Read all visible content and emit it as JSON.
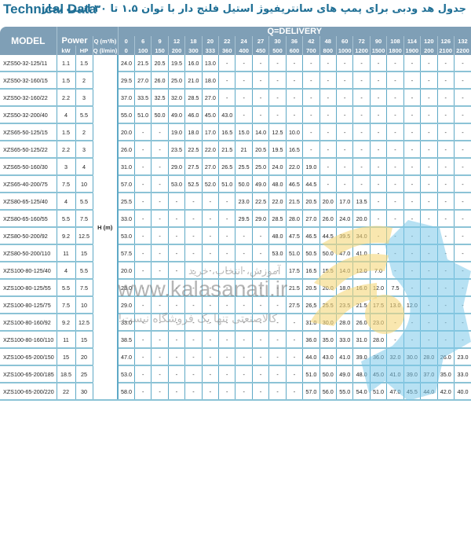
{
  "header": {
    "title_en": "Technical Data",
    "title_fa": "جدول هد ودبی برای پمپ های سانتریفیوژ استیل فلنج دار با توان ۱.۵ تا ۳۰ اسب بخار"
  },
  "table": {
    "model_label": "MODEL",
    "power_label": "Power",
    "kw_label": "kW",
    "hp_label": "HP",
    "q_m3h_label": "Q (m³/h)",
    "q_lmin_label": "Q (l/min)",
    "delivery_label": "Q=DELIVERY",
    "head_label": "H (m)",
    "q_m3h": [
      "0",
      "6",
      "9",
      "12",
      "18",
      "20",
      "22",
      "24",
      "27",
      "30",
      "36",
      "42",
      "48",
      "60",
      "72",
      "90",
      "108",
      "114",
      "120",
      "126",
      "132"
    ],
    "q_lmin": [
      "0",
      "100",
      "150",
      "200",
      "300",
      "333",
      "360",
      "400",
      "450",
      "500",
      "600",
      "700",
      "800",
      "1000",
      "1200",
      "1500",
      "1800",
      "1900",
      "200",
      "2100",
      "2200"
    ],
    "rows": [
      {
        "model": "XZS50-32-125/11",
        "kw": "1.1",
        "hp": "1.5",
        "h": [
          "24.0",
          "21.5",
          "20.5",
          "19.5",
          "16.0",
          "13.0",
          "-",
          "-",
          "-",
          "-",
          "-",
          "-",
          "-",
          "-",
          "-",
          "-",
          "-",
          "-",
          "-",
          "-",
          "-"
        ]
      },
      {
        "model": "XZS50-32-160/15",
        "kw": "1.5",
        "hp": "2",
        "h": [
          "29.5",
          "27.0",
          "26.0",
          "25.0",
          "21.0",
          "18.0",
          "-",
          "-",
          "-",
          "-",
          "-",
          "-",
          "-",
          "-",
          "-",
          "-",
          "-",
          "-",
          "-",
          "-",
          "-"
        ]
      },
      {
        "model": "XZS50-32-160/22",
        "kw": "2.2",
        "hp": "3",
        "h": [
          "37.0",
          "33.5",
          "32.5",
          "32.0",
          "28.5",
          "27.0",
          "-",
          "-",
          "-",
          "-",
          "-",
          "-",
          "-",
          "-",
          "-",
          "-",
          "-",
          "-",
          "-",
          "-",
          "-"
        ]
      },
      {
        "model": "XZS50-32-200/40",
        "kw": "4",
        "hp": "5.5",
        "h": [
          "55.0",
          "51.0",
          "50.0",
          "49.0",
          "46.0",
          "45.0",
          "43.0",
          "-",
          "-",
          "-",
          "-",
          "-",
          "-",
          "-",
          "-",
          "-",
          "-",
          "-",
          "-",
          "-",
          "-"
        ]
      },
      {
        "model": "XZS65-50-125/15",
        "kw": "1.5",
        "hp": "2",
        "h": [
          "20.0",
          "-",
          "-",
          "19.0",
          "18.0",
          "17.0",
          "16.5",
          "15.0",
          "14.0",
          "12.5",
          "10.0",
          "-",
          "-",
          "-",
          "-",
          "-",
          "-",
          "-",
          "-",
          "-",
          "-"
        ]
      },
      {
        "model": "XZS65-50-125/22",
        "kw": "2.2",
        "hp": "3",
        "h": [
          "26.0",
          "-",
          "-",
          "23.5",
          "22.5",
          "22.0",
          "21.5",
          "21",
          "20.5",
          "19.5",
          "16.5",
          "-",
          "-",
          "-",
          "-",
          "-",
          "-",
          "-",
          "-",
          "-",
          "-"
        ]
      },
      {
        "model": "XZS65-50-160/30",
        "kw": "3",
        "hp": "4",
        "h": [
          "31.0",
          "-",
          "-",
          "29.0",
          "27.5",
          "27.0",
          "26.5",
          "25.5",
          "25.0",
          "24.0",
          "22.0",
          "19.0",
          "-",
          "-",
          "-",
          "-",
          "-",
          "-",
          "-",
          "-",
          "-"
        ]
      },
      {
        "model": "XZS65-40-200/75",
        "kw": "7.5",
        "hp": "10",
        "h": [
          "57.0",
          "-",
          "-",
          "53.0",
          "52.5",
          "52.0",
          "51.0",
          "50.0",
          "49.0",
          "48.0",
          "46.5",
          "44.5",
          "-",
          "-",
          "-",
          "-",
          "-",
          "-",
          "-",
          "-",
          "-"
        ]
      },
      {
        "model": "XZS80-65-125/40",
        "kw": "4",
        "hp": "5.5",
        "h": [
          "25.5",
          "-",
          "-",
          "-",
          "-",
          "-",
          "-",
          "23.0",
          "22.5",
          "22.0",
          "21.5",
          "20.5",
          "20.0",
          "17.0",
          "13.5",
          "-",
          "-",
          "-",
          "-",
          "-",
          "-"
        ]
      },
      {
        "model": "XZS80-65-160/55",
        "kw": "5.5",
        "hp": "7.5",
        "h": [
          "33.0",
          "-",
          "-",
          "-",
          "-",
          "-",
          "-",
          "29.5",
          "29.0",
          "28.5",
          "28.0",
          "27.0",
          "26.0",
          "24.0",
          "20.0",
          "-",
          "-",
          "-",
          "-",
          "-",
          "-"
        ]
      },
      {
        "model": "XZS80-50-200/92",
        "kw": "9.2",
        "hp": "12.5",
        "h": [
          "53.0",
          "-",
          "-",
          "-",
          "-",
          "-",
          "-",
          "-",
          "-",
          "48.0",
          "47.5",
          "46.5",
          "44.5",
          "39.5",
          "34.0",
          "-",
          "-",
          "-",
          "-",
          "-",
          "-"
        ]
      },
      {
        "model": "XZS80-50-200/110",
        "kw": "11",
        "hp": "15",
        "h": [
          "57.5",
          "-",
          "-",
          "-",
          "-",
          "-",
          "-",
          "-",
          "-",
          "53.0",
          "51.0",
          "50.5",
          "50.0",
          "47.0",
          "41.0",
          "-",
          "-",
          "-",
          "-",
          "-",
          "-"
        ]
      },
      {
        "model": "XZS100-80-125/40",
        "kw": "4",
        "hp": "5.5",
        "h": [
          "20.0",
          "-",
          "-",
          "-",
          "-",
          "-",
          "-",
          "-",
          "-",
          "-",
          "17.5",
          "16.5",
          "15.5",
          "14.0",
          "12.0",
          "7.0",
          "-",
          "-",
          "-",
          "-",
          "-"
        ]
      },
      {
        "model": "XZS100-80-125/55",
        "kw": "5.5",
        "hp": "7.5",
        "h": [
          "23.0",
          "-",
          "-",
          "-",
          "-",
          "-",
          "-",
          "-",
          "-",
          "-",
          "21.5",
          "20.5",
          "20.0",
          "18.0",
          "16.0",
          "12.0",
          "7.5",
          "-",
          "-",
          "-",
          "-"
        ]
      },
      {
        "model": "XZS100-80-125/75",
        "kw": "7.5",
        "hp": "10",
        "h": [
          "29.0",
          "-",
          "-",
          "-",
          "-",
          "-",
          "-",
          "-",
          "-",
          "-",
          "27.5",
          "26,5",
          "25.5",
          "23.5",
          "21.5",
          "17.5",
          "13.0",
          "12.0",
          "-",
          "-",
          "-"
        ]
      },
      {
        "model": "XZS100-80-160/92",
        "kw": "9.2",
        "hp": "12.5",
        "h": [
          "33.0",
          "-",
          "-",
          "-",
          "-",
          "-",
          "-",
          "-",
          "-",
          "-",
          "-",
          "31.0",
          "30.0",
          "28.0",
          "26.0",
          "23.0",
          "-",
          "-",
          "-",
          "-",
          "-"
        ]
      },
      {
        "model": "XZS100-80-160/110",
        "kw": "11",
        "hp": "15",
        "h": [
          "38.5",
          "-",
          "-",
          "-",
          "-",
          "-",
          "-",
          "-",
          "-",
          "-",
          "-",
          "36.0",
          "35.0",
          "33.0",
          "31.0",
          "28.0",
          "-",
          "-",
          "-",
          "-",
          "-"
        ]
      },
      {
        "model": "XZS100-65-200/150",
        "kw": "15",
        "hp": "20",
        "h": [
          "47.0",
          "-",
          "-",
          "-",
          "-",
          "-",
          "-",
          "-",
          "-",
          "-",
          "-",
          "44.0",
          "43.0",
          "41.0",
          "39.0",
          "36.0",
          "32.0",
          "30.0",
          "28.0",
          "26.0",
          "23.0"
        ]
      },
      {
        "model": "XZS100-65-200/185",
        "kw": "18.5",
        "hp": "25",
        "h": [
          "53.0",
          "-",
          "-",
          "-",
          "-",
          "-",
          "-",
          "-",
          "-",
          "-",
          "-",
          "51.0",
          "50.0",
          "49.0",
          "48.0",
          "45.0",
          "41.0",
          "39.0",
          "37.0",
          "35.0",
          "33.0"
        ]
      },
      {
        "model": "XZS100-65-200/220",
        "kw": "22",
        "hp": "30",
        "h": [
          "58.0",
          "-",
          "-",
          "-",
          "-",
          "-",
          "-",
          "-",
          "-",
          "-",
          "-",
          "57.0",
          "56.0",
          "55.0",
          "54.0",
          "51.0",
          "47.0",
          "45.5",
          "44.0",
          "42.0",
          "40.0"
        ]
      }
    ]
  },
  "watermark": {
    "top_text": "آموزش، انتخاب، خرید",
    "url": "www.kalasanati.ir",
    "bottom_text": "کالاصنعتی تنها یک فروشگاه نیست!",
    "colors": {
      "yellow": "#f5d77a",
      "blue": "#7cc8ea"
    }
  },
  "colors": {
    "header_bg": "#7f9fb6",
    "title": "#1f6f95",
    "grid": "#5ea9c6"
  }
}
